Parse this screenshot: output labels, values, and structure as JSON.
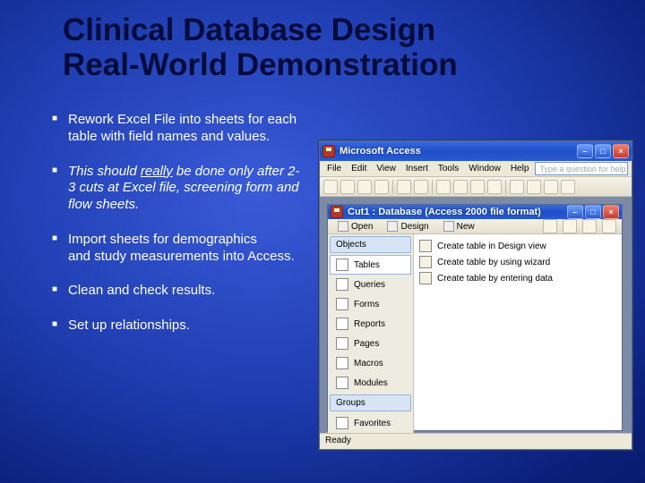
{
  "title_line1": "Clinical Database Design",
  "title_line2": "Real-World Demonstration",
  "bullets": {
    "b1": "Rework Excel File into sheets for each table with field names and values.",
    "b2_pre": "This should ",
    "b2_ul": "really",
    "b2_post": " be done only after 2-3 cuts at Excel file, screening form and flow sheets.",
    "b3a": "Import sheets for demographics",
    "b3b": "and study measurements into Access.",
    "b4": "Clean and check results.",
    "b5": "Set up relationships."
  },
  "access": {
    "app_title": "Microsoft Access",
    "menu": {
      "file": "File",
      "edit": "Edit",
      "view": "View",
      "insert": "Insert",
      "tools": "Tools",
      "window": "Window",
      "help": "Help"
    },
    "help_placeholder": "Type a question for help",
    "db_title": "Cut1 : Database (Access 2000 file format)",
    "db_toolbar": {
      "open": "Open",
      "design": "Design",
      "new": "New"
    },
    "nav": {
      "objects": "Objects",
      "tables": "Tables",
      "queries": "Queries",
      "forms": "Forms",
      "reports": "Reports",
      "pages": "Pages",
      "macros": "Macros",
      "modules": "Modules",
      "groups": "Groups",
      "favorites": "Favorites"
    },
    "list": {
      "r1": "Create table in Design view",
      "r2": "Create table by using wizard",
      "r3": "Create table by entering data"
    },
    "status": "Ready"
  }
}
